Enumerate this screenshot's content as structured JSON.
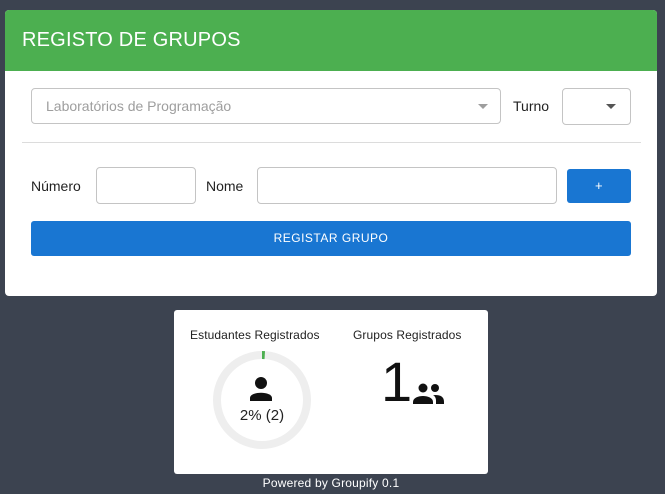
{
  "header": {
    "title": "REGISTO DE GRUPOS"
  },
  "form": {
    "course_select_value": "Laboratórios de Programação",
    "turno_label": "Turno",
    "turno_value": "",
    "numero_label": "Número",
    "numero_value": "",
    "nome_label": "Nome",
    "nome_value": "",
    "add_label": "+",
    "register_label": "REGISTAR GRUPO"
  },
  "stats": {
    "students_title": "Estudantes Registrados",
    "students_percent_text": "2% (2)",
    "students_fraction": 0.02,
    "groups_title": "Grupos Registrados",
    "groups_count": "1",
    "progress_color": "#4caf50",
    "track_color": "#eeeeee",
    "person_icon": "person-icon",
    "group_icon": "group-icon"
  },
  "footer": {
    "text": "Powered by Groupify 0.1"
  },
  "colors": {
    "header": "#4caf50",
    "primary": "#1976d2",
    "background": "#3c4350"
  }
}
